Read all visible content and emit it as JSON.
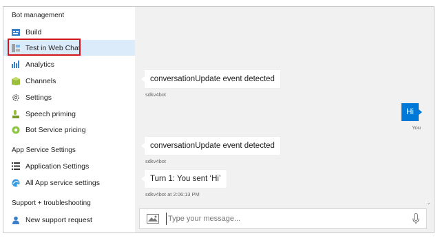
{
  "sidebar": {
    "sections": [
      {
        "title": "Bot management"
      },
      {
        "title": "App Service Settings"
      },
      {
        "title": "Support + troubleshooting"
      }
    ],
    "items": [
      {
        "label": "Build",
        "icon": "build-icon"
      },
      {
        "label": "Test in Web Chat",
        "icon": "webchat-icon",
        "selected": true
      },
      {
        "label": "Analytics",
        "icon": "analytics-icon"
      },
      {
        "label": "Channels",
        "icon": "channels-icon"
      },
      {
        "label": "Settings",
        "icon": "gear-icon"
      },
      {
        "label": "Speech priming",
        "icon": "speech-icon"
      },
      {
        "label": "Bot Service pricing",
        "icon": "pricing-icon"
      },
      {
        "label": "Application Settings",
        "icon": "list-icon"
      },
      {
        "label": "All App service settings",
        "icon": "app-service-icon"
      },
      {
        "label": "New support request",
        "icon": "support-icon"
      }
    ]
  },
  "chat": {
    "messages": [
      {
        "text": "conversationUpdate event detected",
        "meta": "sdkv4bot",
        "from": "bot"
      },
      {
        "text": "Hi",
        "meta": "You",
        "from": "user"
      },
      {
        "text": "conversationUpdate event detected",
        "meta": "sdkv4bot",
        "from": "bot"
      },
      {
        "text": "Turn 1: You sent ‘Hi’",
        "meta": "sdkv4bot at 2:06:13 PM",
        "from": "bot"
      }
    ],
    "input_placeholder": "Type your message..."
  },
  "colors": {
    "accent": "#0078d7",
    "selected_bg": "#dcebfa",
    "highlight": "#d4141c",
    "chat_bg": "#f1f1f1"
  }
}
